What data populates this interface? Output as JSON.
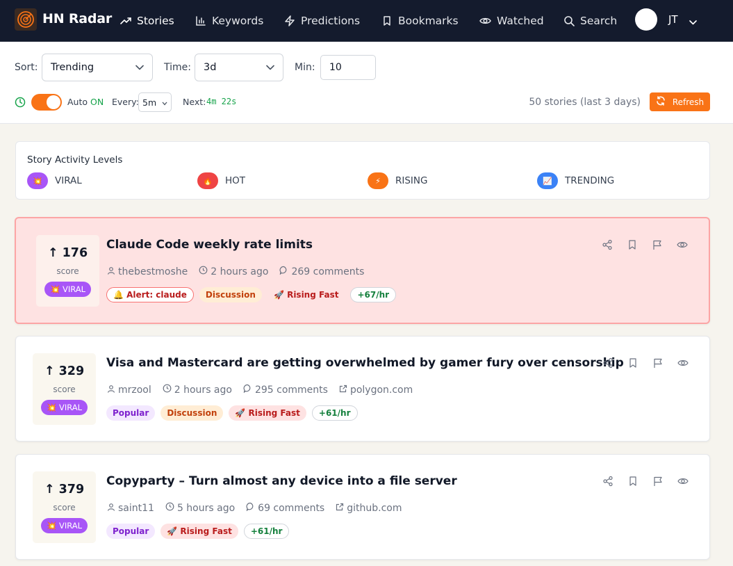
{
  "nav": {
    "brand": "HN Radar",
    "items": [
      {
        "label": "Stories",
        "icon": "trending-up-icon"
      },
      {
        "label": "Keywords",
        "icon": "bar-chart-icon"
      },
      {
        "label": "Predictions",
        "icon": "zap-icon"
      },
      {
        "label": "Bookmarks",
        "icon": "bookmark-icon"
      },
      {
        "label": "Watched",
        "icon": "eye-icon"
      },
      {
        "label": "Search",
        "icon": "search-icon"
      }
    ],
    "user_initials": "JT"
  },
  "filters": {
    "sort_label": "Sort:",
    "sort_value": "Trending",
    "time_label": "Time:",
    "time_value": "3d",
    "min_label": "Min:",
    "min_value": "10",
    "auto_label": "Auto",
    "auto_state": "ON",
    "every_label": "Every:",
    "every_value": "5m",
    "next_label": "Next:",
    "next_value": "4m 22s",
    "story_count": "50 stories (last 3 days)",
    "refresh_label": "Refresh"
  },
  "legend": {
    "title": "Story Activity Levels",
    "items": [
      {
        "label": "VIRAL",
        "emoji": "💥",
        "color": "#a855f7"
      },
      {
        "label": "HOT",
        "emoji": "🔥",
        "color": "#ef4444"
      },
      {
        "label": "RISING",
        "emoji": "⚡",
        "color": "#f97316"
      },
      {
        "label": "TRENDING",
        "emoji": "📈",
        "color": "#3b82f6"
      }
    ]
  },
  "stories": [
    {
      "score": "176",
      "score_label": "score",
      "badge": "💥 VIRAL",
      "title": "Claude Code weekly rate limits",
      "author": "thebestmoshe",
      "time": "2 hours ago",
      "comments": "269 comments",
      "domain": "",
      "tags": [
        {
          "label": "🔔 Alert: claude",
          "kind": "alert"
        },
        {
          "label": "Discussion",
          "kind": "discussion"
        },
        {
          "label": "🚀 Rising Fast",
          "kind": "rising"
        },
        {
          "label": "+67/hr",
          "kind": "rate"
        }
      ]
    },
    {
      "score": "329",
      "score_label": "score",
      "badge": "💥 VIRAL",
      "title": "Visa and Mastercard are getting overwhelmed by gamer fury over censorship",
      "author": "mrzool",
      "time": "2 hours ago",
      "comments": "295 comments",
      "domain": "polygon.com",
      "tags": [
        {
          "label": "Popular",
          "kind": "popular"
        },
        {
          "label": "Discussion",
          "kind": "discussion"
        },
        {
          "label": "🚀 Rising Fast",
          "kind": "rising"
        },
        {
          "label": "+61/hr",
          "kind": "rate"
        }
      ]
    },
    {
      "score": "379",
      "score_label": "score",
      "badge": "💥 VIRAL",
      "title": "Copyparty – Turn almost any device into a file server",
      "author": "saint11",
      "time": "5 hours ago",
      "comments": "69 comments",
      "domain": "github.com",
      "tags": [
        {
          "label": "Popular",
          "kind": "popular"
        },
        {
          "label": "🚀 Rising Fast",
          "kind": "rising"
        },
        {
          "label": "+61/hr",
          "kind": "rate"
        }
      ]
    }
  ]
}
